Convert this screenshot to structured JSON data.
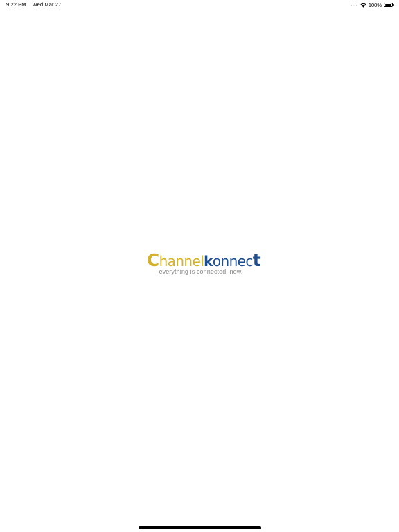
{
  "status_bar": {
    "time": "9:22 PM",
    "date": "Wed Mar 27",
    "signal": "....",
    "battery": "100%",
    "wifi_icon": "wifi-icon",
    "battery_icon": "battery-icon"
  },
  "logo": {
    "c": "C",
    "hannel": "hanne",
    "l": "l",
    "k": "k",
    "onnec": "onnec",
    "t": "t",
    "tagline": "everything is connected. now."
  },
  "colors": {
    "channel": "#d4b22b",
    "konnect": "#1f4f8e",
    "tagline": "#8a8a8a"
  }
}
